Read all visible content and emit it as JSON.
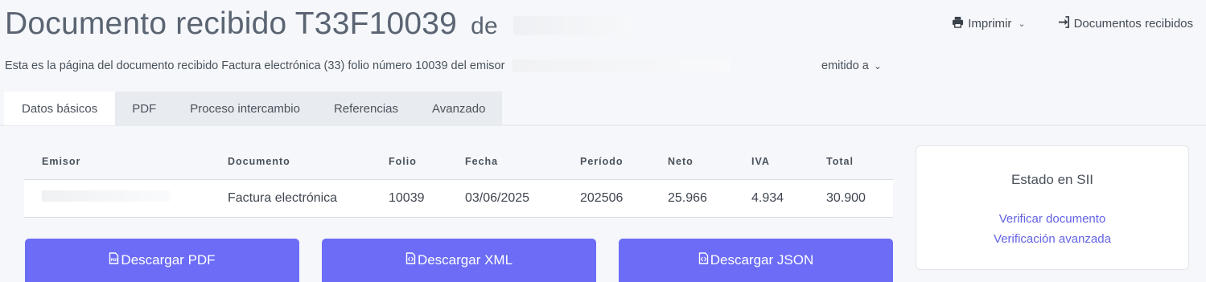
{
  "header": {
    "title": "Documento recibido T33F10039",
    "title_suffix": "de",
    "subtitle": "Esta es la página del documento recibido Factura electrónica (33) folio número 10039 del emisor",
    "subtitle_tail": "emitido a"
  },
  "actions": {
    "print_label": "Imprimir",
    "received_label": "Documentos recibidos"
  },
  "tabs": [
    {
      "label": "Datos básicos"
    },
    {
      "label": "PDF"
    },
    {
      "label": "Proceso intercambio"
    },
    {
      "label": "Referencias"
    },
    {
      "label": "Avanzado"
    }
  ],
  "table": {
    "headers": [
      "Emisor",
      "Documento",
      "Folio",
      "Fecha",
      "Período",
      "Neto",
      "IVA",
      "Total"
    ],
    "row": {
      "documento": "Factura electrónica",
      "folio": "10039",
      "fecha": "03/06/2025",
      "periodo": "202506",
      "neto": "25.966",
      "iva": "4.934",
      "total": "30.900"
    }
  },
  "buttons": {
    "pdf": "Descargar PDF",
    "xml": "Descargar XML",
    "json": "Descargar JSON"
  },
  "status": {
    "title": "Estado en SII",
    "verify": "Verificar documento",
    "verify_advanced": "Verificación avanzada"
  },
  "colors": {
    "accent": "#6c6cf6",
    "link": "#6262e6"
  }
}
